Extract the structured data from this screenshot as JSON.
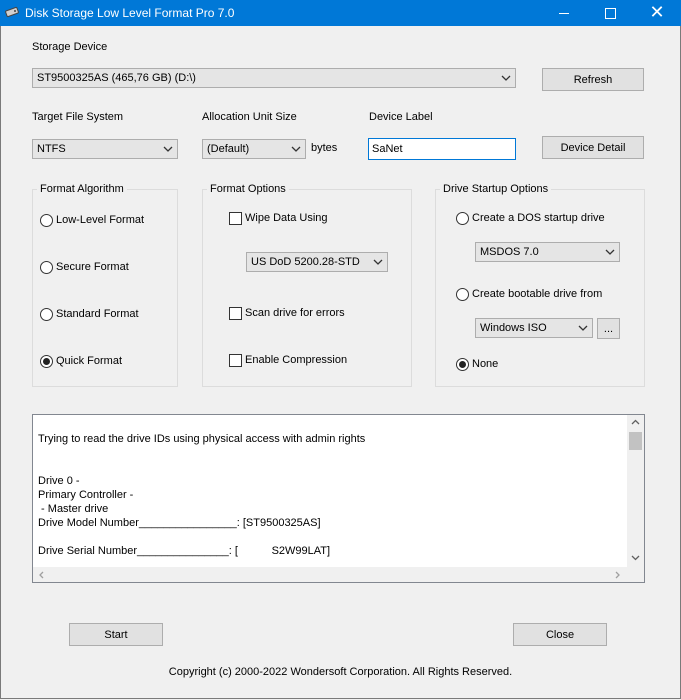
{
  "window": {
    "title": "Disk Storage Low Level Format Pro 7.0",
    "icon": "disk-drive-icon"
  },
  "storage": {
    "label": "Storage Device",
    "selected": "ST9500325AS (465,76 GB) (D:\\)",
    "refresh_label": "Refresh"
  },
  "filesystem": {
    "label": "Target File System",
    "selected": "NTFS"
  },
  "allocation": {
    "label": "Allocation Unit Size",
    "selected": "(Default)",
    "unit": "bytes"
  },
  "device_label": {
    "label": "Device Label",
    "value": "SaNet",
    "detail_button": "Device Detail"
  },
  "format_algorithm": {
    "title": "Format Algorithm",
    "options": [
      "Low-Level Format",
      "Secure Format",
      "Standard Format",
      "Quick Format"
    ],
    "selected": "Quick Format"
  },
  "format_options": {
    "title": "Format Options",
    "wipe_label": "Wipe Data Using",
    "wipe_method": "US DoD 5200.28-STD",
    "scan_label": "Scan drive for errors",
    "compression_label": "Enable Compression"
  },
  "startup": {
    "title": "Drive Startup Options",
    "dos_label": "Create a DOS startup drive",
    "dos_version": "MSDOS 7.0",
    "bootable_label": "Create bootable drive from",
    "bootable_source": "Windows ISO",
    "browse_label": "...",
    "none_label": "None",
    "selected": "None"
  },
  "log": {
    "lines": [
      "Trying to read the drive IDs using physical access with admin rights",
      "",
      "",
      "Drive 0 -",
      "Primary Controller -",
      " - Master drive",
      "Drive Model Number________________: [ST9500325AS]",
      "",
      "Drive Serial Number_______________: [           S2W99LAT]"
    ]
  },
  "footer": {
    "start_label": "Start",
    "close_label": "Close",
    "copyright": "Copyright (c) 2000-2022 Wondersoft Corporation. All Rights Reserved."
  }
}
